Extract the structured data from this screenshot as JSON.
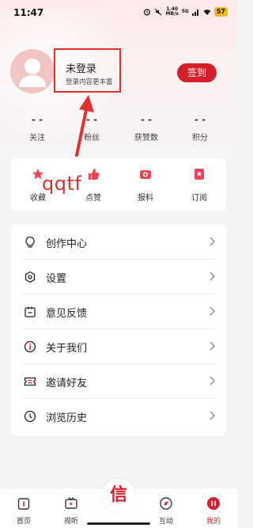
{
  "status_bar": {
    "time": "11:47",
    "network_speed": "1.40",
    "network_unit": "MB/s",
    "signal": "5G",
    "battery": "57"
  },
  "profile": {
    "login_title": "未登录",
    "login_subtitle": "登录内容更丰富",
    "signin_button": "签到"
  },
  "annotation": {
    "text": "qqtf",
    "color": "#e03030"
  },
  "stats": [
    {
      "value": "- -",
      "label": "关注"
    },
    {
      "value": "- -",
      "label": "粉丝"
    },
    {
      "value": "- -",
      "label": "获赞数"
    },
    {
      "value": "- -",
      "label": "积分"
    }
  ],
  "quick_actions": [
    {
      "label": "收藏",
      "icon": "star-icon"
    },
    {
      "label": "点赞",
      "icon": "thumb-up-icon"
    },
    {
      "label": "报料",
      "icon": "camera-icon"
    },
    {
      "label": "订阅",
      "icon": "subscribe-icon"
    }
  ],
  "menu": [
    {
      "label": "创作中心",
      "icon": "lightbulb-icon"
    },
    {
      "label": "设置",
      "icon": "gear-icon"
    },
    {
      "label": "意见反馈",
      "icon": "feedback-icon"
    },
    {
      "label": "关于我们",
      "icon": "info-icon"
    },
    {
      "label": "邀请好友",
      "icon": "ticket-icon"
    },
    {
      "label": "浏览历史",
      "icon": "clock-icon"
    }
  ],
  "bottom_nav": [
    {
      "label": "首页",
      "icon": "home-icon"
    },
    {
      "label": "视听",
      "icon": "tv-icon"
    },
    {
      "label": "互动",
      "icon": "compass-icon"
    },
    {
      "label": "我的",
      "icon": "profile-icon"
    }
  ],
  "center_logo": "信",
  "colors": {
    "accent": "#d61f2b",
    "background": "#f4f4f4",
    "card": "#ffffff"
  }
}
